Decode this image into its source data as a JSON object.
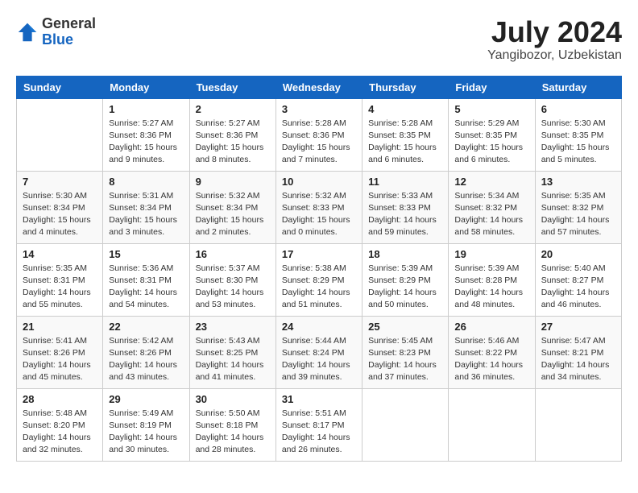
{
  "logo": {
    "general": "General",
    "blue": "Blue"
  },
  "title": {
    "month_year": "July 2024",
    "location": "Yangibozor, Uzbekistan"
  },
  "weekdays": [
    "Sunday",
    "Monday",
    "Tuesday",
    "Wednesday",
    "Thursday",
    "Friday",
    "Saturday"
  ],
  "weeks": [
    [
      {
        "day": "",
        "info": ""
      },
      {
        "day": "1",
        "info": "Sunrise: 5:27 AM\nSunset: 8:36 PM\nDaylight: 15 hours\nand 9 minutes."
      },
      {
        "day": "2",
        "info": "Sunrise: 5:27 AM\nSunset: 8:36 PM\nDaylight: 15 hours\nand 8 minutes."
      },
      {
        "day": "3",
        "info": "Sunrise: 5:28 AM\nSunset: 8:36 PM\nDaylight: 15 hours\nand 7 minutes."
      },
      {
        "day": "4",
        "info": "Sunrise: 5:28 AM\nSunset: 8:35 PM\nDaylight: 15 hours\nand 6 minutes."
      },
      {
        "day": "5",
        "info": "Sunrise: 5:29 AM\nSunset: 8:35 PM\nDaylight: 15 hours\nand 6 minutes."
      },
      {
        "day": "6",
        "info": "Sunrise: 5:30 AM\nSunset: 8:35 PM\nDaylight: 15 hours\nand 5 minutes."
      }
    ],
    [
      {
        "day": "7",
        "info": "Sunrise: 5:30 AM\nSunset: 8:34 PM\nDaylight: 15 hours\nand 4 minutes."
      },
      {
        "day": "8",
        "info": "Sunrise: 5:31 AM\nSunset: 8:34 PM\nDaylight: 15 hours\nand 3 minutes."
      },
      {
        "day": "9",
        "info": "Sunrise: 5:32 AM\nSunset: 8:34 PM\nDaylight: 15 hours\nand 2 minutes."
      },
      {
        "day": "10",
        "info": "Sunrise: 5:32 AM\nSunset: 8:33 PM\nDaylight: 15 hours\nand 0 minutes."
      },
      {
        "day": "11",
        "info": "Sunrise: 5:33 AM\nSunset: 8:33 PM\nDaylight: 14 hours\nand 59 minutes."
      },
      {
        "day": "12",
        "info": "Sunrise: 5:34 AM\nSunset: 8:32 PM\nDaylight: 14 hours\nand 58 minutes."
      },
      {
        "day": "13",
        "info": "Sunrise: 5:35 AM\nSunset: 8:32 PM\nDaylight: 14 hours\nand 57 minutes."
      }
    ],
    [
      {
        "day": "14",
        "info": "Sunrise: 5:35 AM\nSunset: 8:31 PM\nDaylight: 14 hours\nand 55 minutes."
      },
      {
        "day": "15",
        "info": "Sunrise: 5:36 AM\nSunset: 8:31 PM\nDaylight: 14 hours\nand 54 minutes."
      },
      {
        "day": "16",
        "info": "Sunrise: 5:37 AM\nSunset: 8:30 PM\nDaylight: 14 hours\nand 53 minutes."
      },
      {
        "day": "17",
        "info": "Sunrise: 5:38 AM\nSunset: 8:29 PM\nDaylight: 14 hours\nand 51 minutes."
      },
      {
        "day": "18",
        "info": "Sunrise: 5:39 AM\nSunset: 8:29 PM\nDaylight: 14 hours\nand 50 minutes."
      },
      {
        "day": "19",
        "info": "Sunrise: 5:39 AM\nSunset: 8:28 PM\nDaylight: 14 hours\nand 48 minutes."
      },
      {
        "day": "20",
        "info": "Sunrise: 5:40 AM\nSunset: 8:27 PM\nDaylight: 14 hours\nand 46 minutes."
      }
    ],
    [
      {
        "day": "21",
        "info": "Sunrise: 5:41 AM\nSunset: 8:26 PM\nDaylight: 14 hours\nand 45 minutes."
      },
      {
        "day": "22",
        "info": "Sunrise: 5:42 AM\nSunset: 8:26 PM\nDaylight: 14 hours\nand 43 minutes."
      },
      {
        "day": "23",
        "info": "Sunrise: 5:43 AM\nSunset: 8:25 PM\nDaylight: 14 hours\nand 41 minutes."
      },
      {
        "day": "24",
        "info": "Sunrise: 5:44 AM\nSunset: 8:24 PM\nDaylight: 14 hours\nand 39 minutes."
      },
      {
        "day": "25",
        "info": "Sunrise: 5:45 AM\nSunset: 8:23 PM\nDaylight: 14 hours\nand 37 minutes."
      },
      {
        "day": "26",
        "info": "Sunrise: 5:46 AM\nSunset: 8:22 PM\nDaylight: 14 hours\nand 36 minutes."
      },
      {
        "day": "27",
        "info": "Sunrise: 5:47 AM\nSunset: 8:21 PM\nDaylight: 14 hours\nand 34 minutes."
      }
    ],
    [
      {
        "day": "28",
        "info": "Sunrise: 5:48 AM\nSunset: 8:20 PM\nDaylight: 14 hours\nand 32 minutes."
      },
      {
        "day": "29",
        "info": "Sunrise: 5:49 AM\nSunset: 8:19 PM\nDaylight: 14 hours\nand 30 minutes."
      },
      {
        "day": "30",
        "info": "Sunrise: 5:50 AM\nSunset: 8:18 PM\nDaylight: 14 hours\nand 28 minutes."
      },
      {
        "day": "31",
        "info": "Sunrise: 5:51 AM\nSunset: 8:17 PM\nDaylight: 14 hours\nand 26 minutes."
      },
      {
        "day": "",
        "info": ""
      },
      {
        "day": "",
        "info": ""
      },
      {
        "day": "",
        "info": ""
      }
    ]
  ]
}
